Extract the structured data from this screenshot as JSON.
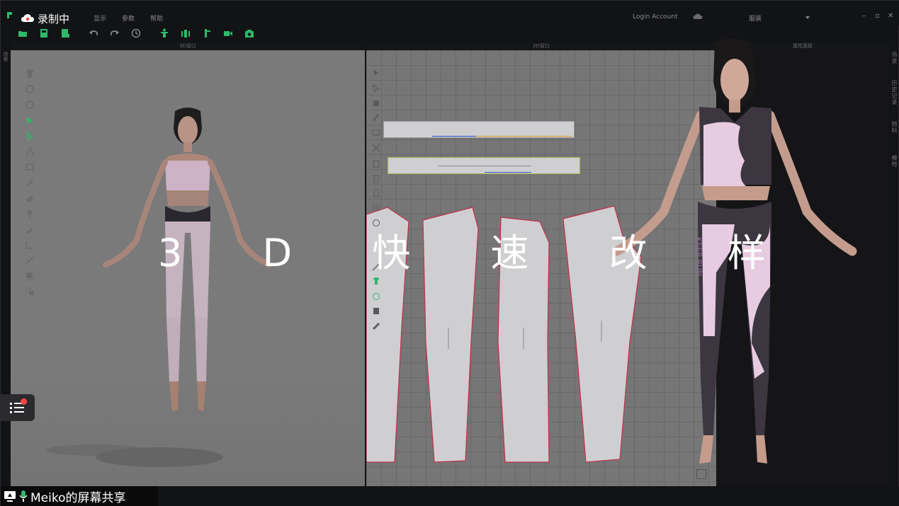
{
  "recording": {
    "label": "录制中"
  },
  "menu": {
    "items": [
      "显示",
      "参数",
      "帮助"
    ]
  },
  "account": {
    "login_label": "Login Account"
  },
  "preset": {
    "label": "服装"
  },
  "window_buttons": [
    "–",
    "▫",
    "✕"
  ],
  "panels": {
    "view3d_title": "3D窗口",
    "view2d_title": "2D窗口",
    "property_title": "属性面板",
    "left_tab": "场景"
  },
  "side_tabs": [
    "场景",
    "历史记录",
    "物料",
    "模特"
  ],
  "overlay": {
    "title": "3 D 快 速 改 样"
  },
  "model": {
    "legging_text": "KEEP RUN"
  },
  "share": {
    "label": "Meiko的屏幕共享"
  },
  "colors": {
    "accent_green": "#2fb86a",
    "pink": "#e7cbe0",
    "charcoal": "#3b3640",
    "pattern_fill": "#cfcfd1",
    "pattern_edge": "#c0304a"
  }
}
